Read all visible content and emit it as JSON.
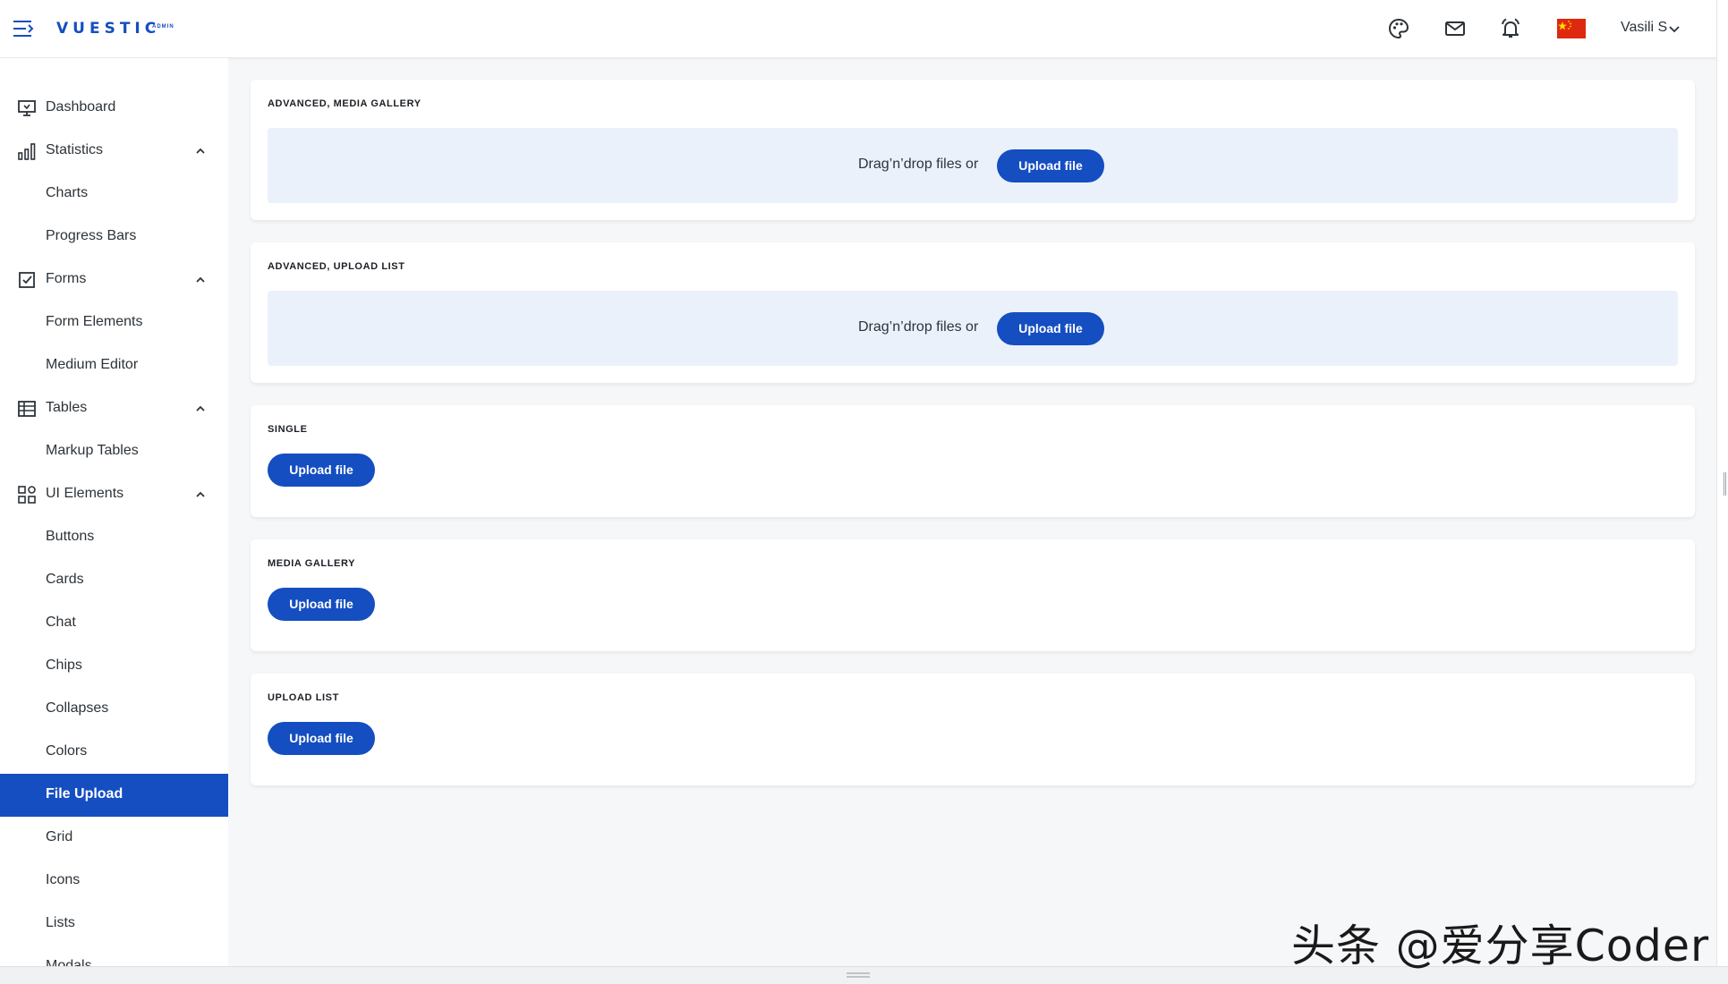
{
  "header": {
    "logo_text": "VUESTIC",
    "logo_sub": "ADMIN",
    "user_name": "Vasili S",
    "flag_color": "#de2910",
    "icons": [
      "menu-toggle-icon",
      "palette-icon",
      "mail-icon",
      "bell-icon",
      "china-flag-icon"
    ]
  },
  "sidebar": {
    "active_color": "#154ec1",
    "items": [
      {
        "label": "Dashboard",
        "icon": "monitor-icon"
      },
      {
        "label": "Statistics",
        "icon": "bar-chart-icon",
        "expanded": true
      },
      {
        "label": "Charts"
      },
      {
        "label": "Progress Bars"
      },
      {
        "label": "Forms",
        "icon": "checkbox-icon",
        "expanded": true
      },
      {
        "label": "Form Elements"
      },
      {
        "label": "Medium Editor"
      },
      {
        "label": "Tables",
        "icon": "table-icon",
        "expanded": true
      },
      {
        "label": "Markup Tables"
      },
      {
        "label": "UI Elements",
        "icon": "grid-shapes-icon",
        "expanded": true
      },
      {
        "label": "Buttons"
      },
      {
        "label": "Cards"
      },
      {
        "label": "Chat"
      },
      {
        "label": "Chips"
      },
      {
        "label": "Collapses"
      },
      {
        "label": "Colors"
      },
      {
        "label": "File Upload",
        "active": true
      },
      {
        "label": "Grid"
      },
      {
        "label": "Icons"
      },
      {
        "label": "Lists"
      },
      {
        "label": "Modals"
      }
    ]
  },
  "cards": [
    {
      "title": "ADVANCED, MEDIA GALLERY",
      "dropzone_text": "Drag’n’drop files or",
      "button": "Upload file"
    },
    {
      "title": "ADVANCED, UPLOAD LIST",
      "dropzone_text": "Drag’n’drop files or",
      "button": "Upload file"
    },
    {
      "title": "SINGLE",
      "button": "Upload file"
    },
    {
      "title": "MEDIA GALLERY",
      "button": "Upload file"
    },
    {
      "title": "UPLOAD LIST",
      "button": "Upload file"
    }
  ],
  "watermark": "头条 @爱分享Coder"
}
